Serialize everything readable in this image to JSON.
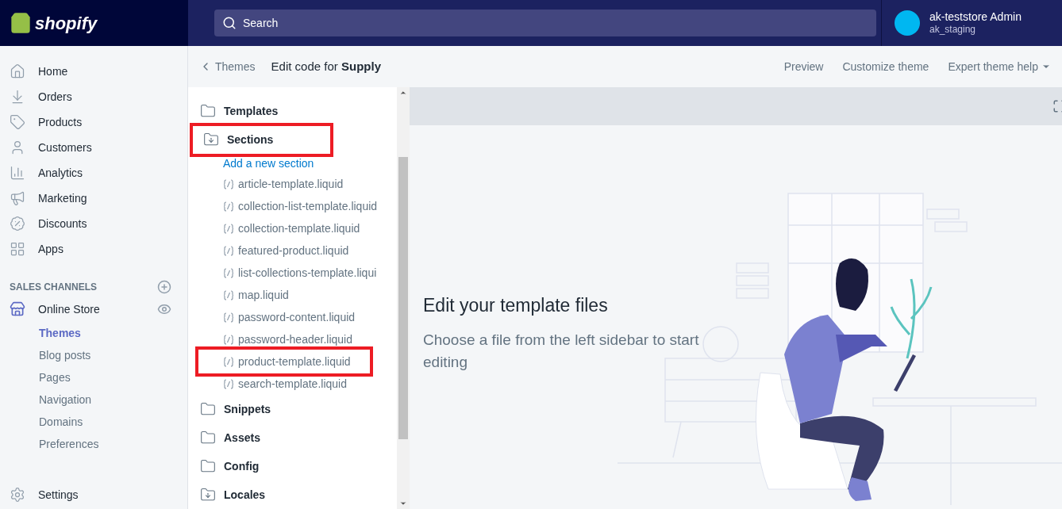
{
  "topbar": {
    "logo_text": "shopify",
    "search": {
      "placeholder": "Search"
    },
    "account": {
      "name": "ak-teststore Admin",
      "store": "ak_staging"
    }
  },
  "sidebar": {
    "items": [
      {
        "label": "Home",
        "selected": false
      },
      {
        "label": "Orders",
        "selected": false
      },
      {
        "label": "Products",
        "selected": false
      },
      {
        "label": "Customers",
        "selected": false
      },
      {
        "label": "Analytics",
        "selected": false
      },
      {
        "label": "Marketing",
        "selected": false
      },
      {
        "label": "Discounts",
        "selected": false
      },
      {
        "label": "Apps",
        "selected": false
      }
    ],
    "channels_heading": "SALES CHANNELS",
    "channel": {
      "label": "Online Store",
      "children": [
        {
          "label": "Themes",
          "selected": true
        },
        {
          "label": "Blog posts",
          "selected": false
        },
        {
          "label": "Pages",
          "selected": false
        },
        {
          "label": "Navigation",
          "selected": false
        },
        {
          "label": "Domains",
          "selected": false
        },
        {
          "label": "Preferences",
          "selected": false
        }
      ]
    },
    "settings": "Settings"
  },
  "header": {
    "back": "Themes",
    "title": "Edit code for **Supply**",
    "actions": [
      {
        "label": "Preview",
        "dropdown": false
      },
      {
        "label": "Customize theme",
        "dropdown": false
      },
      {
        "label": "Expert theme help",
        "dropdown": true
      }
    ]
  },
  "file_tree": [
    {
      "label": "Templates",
      "kind": "folder",
      "highlighted": false
    },
    {
      "label": "Sections",
      "kind": "marked-folder",
      "highlighted": true,
      "add_link": "Add a new section",
      "children": [
        {
          "label": "article-template.liquid",
          "highlighted": false
        },
        {
          "label": "collection-list-template.liquid",
          "highlighted": false
        },
        {
          "label": "collection-template.liquid",
          "highlighted": false
        },
        {
          "label": "featured-product.liquid",
          "highlighted": false
        },
        {
          "label": "list-collections-template.liqui",
          "highlighted": false
        },
        {
          "label": "map.liquid",
          "highlighted": false
        },
        {
          "label": "password-content.liquid",
          "highlighted": false
        },
        {
          "label": "password-header.liquid",
          "highlighted": false
        },
        {
          "label": "product-template.liquid",
          "highlighted": true
        },
        {
          "label": "search-template.liquid",
          "highlighted": false
        }
      ]
    },
    {
      "label": "Snippets",
      "kind": "folder",
      "highlighted": false
    },
    {
      "label": "Assets",
      "kind": "folder",
      "highlighted": false
    },
    {
      "label": "Config",
      "kind": "folder",
      "highlighted": false
    },
    {
      "label": "Locales",
      "kind": "marked-folder",
      "highlighted": false
    }
  ],
  "empty_state": {
    "title": "Edit your template files",
    "text": "Choose a file from the left sidebar to start editing"
  }
}
